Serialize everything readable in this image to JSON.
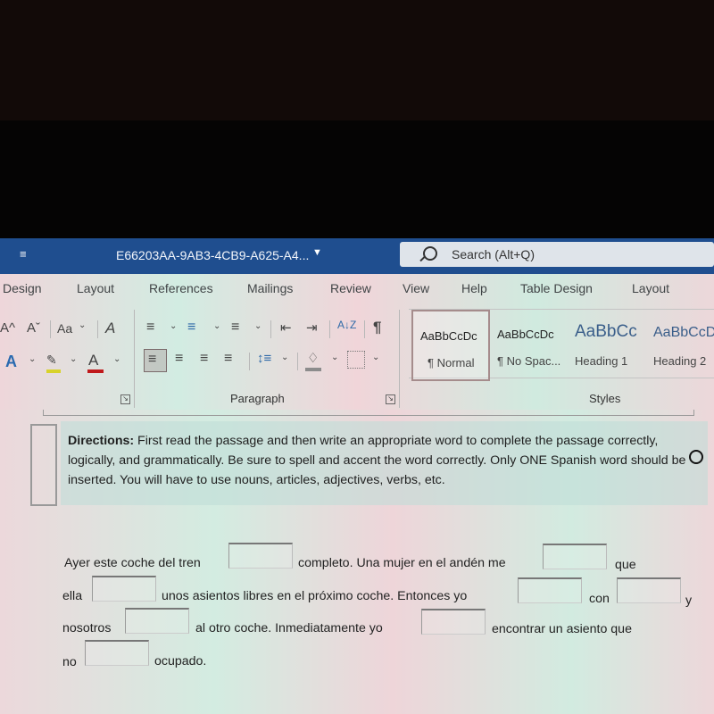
{
  "window": {
    "document_title": "E66203AA-9AB3-4CB9-A625-A4...",
    "search_placeholder": "Search (Alt+Q)"
  },
  "ribbon_tabs": [
    "Design",
    "Layout",
    "References",
    "Mailings",
    "Review",
    "View",
    "Help",
    "Table Design",
    "Layout"
  ],
  "font_group": {
    "grow_font": "A^",
    "shrink_font": "Aˇ",
    "change_case": "Aa",
    "clear_formatting": "A",
    "text_effects": "A",
    "highlight_color": "#d8d22a",
    "font_color": "#c0191b"
  },
  "paragraph_group": {
    "label": "Paragraph",
    "sort_label": "A↓Z",
    "pilcrow": "¶"
  },
  "styles_group": {
    "label": "Styles",
    "items": [
      {
        "preview": "AaBbCcDc",
        "name": "¶ Normal",
        "selected": true
      },
      {
        "preview": "AaBbCcDc",
        "name": "¶ No Spac...",
        "selected": false
      },
      {
        "preview": "AaBbCc",
        "name": "Heading 1",
        "selected": false
      },
      {
        "preview": "AaBbCcD",
        "name": "Heading 2",
        "selected": false
      }
    ]
  },
  "document": {
    "directions_label": "Directions:",
    "directions_text": " First read the passage and then write an appropriate word to complete the passage correctly, logically, and grammatically. Be sure to spell and accent the word correctly. Only ONE Spanish word should be inserted. You will have to use nouns, articles, adjectives, verbs, etc.",
    "passage": {
      "line1": [
        "Ayer este coche del tren",
        "completo. Una mujer en el andén me",
        "que"
      ],
      "line2": [
        "ella",
        "unos asientos libres en el próximo coche. Entonces yo",
        "con",
        "y"
      ],
      "line3": [
        "nosotros",
        "al otro coche. Inmediatamente yo",
        "encontrar un asiento que"
      ],
      "line4": [
        "no",
        "ocupado."
      ]
    },
    "blanks": [
      "",
      "",
      "",
      "",
      "",
      "",
      "",
      "",
      ""
    ]
  }
}
